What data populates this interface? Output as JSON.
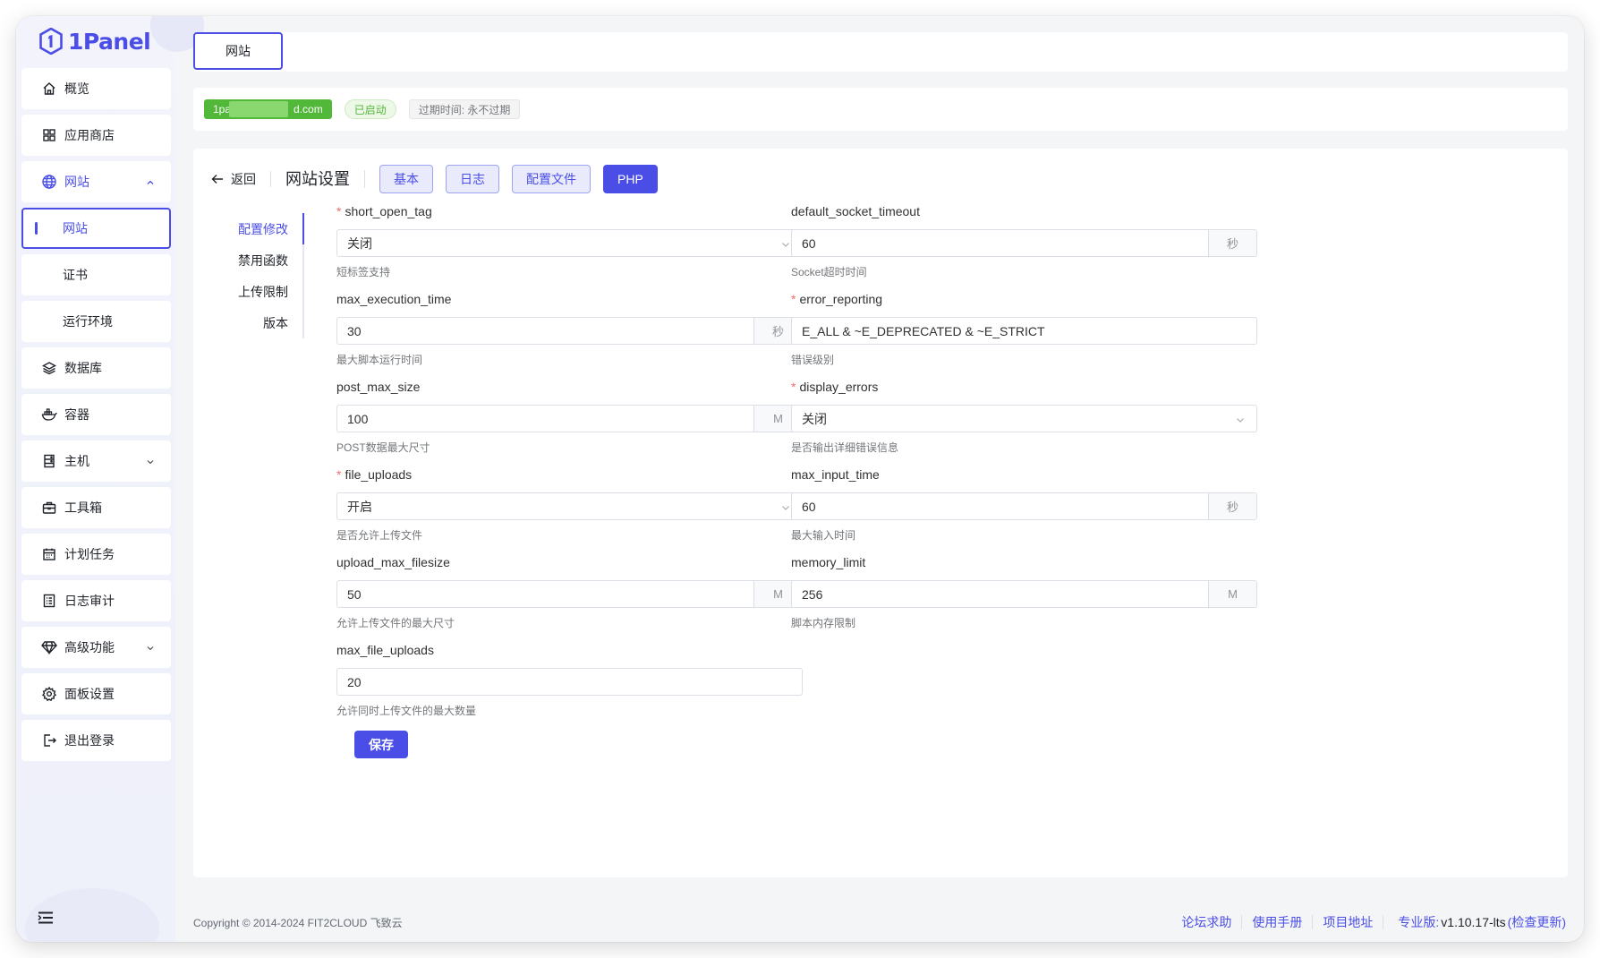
{
  "app": {
    "name": "1Panel"
  },
  "sidebar": {
    "items": [
      {
        "label": "概览"
      },
      {
        "label": "应用商店"
      },
      {
        "label": "网站"
      },
      {
        "label": "网站"
      },
      {
        "label": "证书"
      },
      {
        "label": "运行环境"
      },
      {
        "label": "数据库"
      },
      {
        "label": "容器"
      },
      {
        "label": "主机"
      },
      {
        "label": "工具箱"
      },
      {
        "label": "计划任务"
      },
      {
        "label": "日志审计"
      },
      {
        "label": "高级功能"
      },
      {
        "label": "面板设置"
      },
      {
        "label": "退出登录"
      }
    ]
  },
  "tabs": {
    "active": "网站"
  },
  "site": {
    "domain_prefix": "1pa",
    "domain_suffix": "d.com",
    "status": "已启动",
    "expire": "过期时间: 永不过期"
  },
  "header": {
    "back": "返回",
    "title": "网站设置",
    "buttons": [
      "基本",
      "日志",
      "配置文件",
      "PHP"
    ]
  },
  "subnav": [
    "配置修改",
    "禁用函数",
    "上传限制",
    "版本"
  ],
  "form": {
    "short_open_tag": {
      "label": "short_open_tag",
      "value": "关闭",
      "help": "短标签支持"
    },
    "default_socket_timeout": {
      "label": "default_socket_timeout",
      "value": "60",
      "unit": "秒",
      "help": "Socket超时时间"
    },
    "max_execution_time": {
      "label": "max_execution_time",
      "value": "30",
      "unit": "秒",
      "help": "最大脚本运行时间"
    },
    "error_reporting": {
      "label": "error_reporting",
      "value": "E_ALL & ~E_DEPRECATED & ~E_STRICT",
      "help": "错误级别"
    },
    "post_max_size": {
      "label": "post_max_size",
      "value": "100",
      "unit": "M",
      "help": "POST数据最大尺寸"
    },
    "display_errors": {
      "label": "display_errors",
      "value": "关闭",
      "help": "是否输出详细错误信息"
    },
    "file_uploads": {
      "label": "file_uploads",
      "value": "开启",
      "help": "是否允许上传文件"
    },
    "max_input_time": {
      "label": "max_input_time",
      "value": "60",
      "unit": "秒",
      "help": "最大输入时间"
    },
    "upload_max_filesize": {
      "label": "upload_max_filesize",
      "value": "50",
      "unit": "M",
      "help": "允许上传文件的最大尺寸"
    },
    "memory_limit": {
      "label": "memory_limit",
      "value": "256",
      "unit": "M",
      "help": "脚本内存限制"
    },
    "max_file_uploads": {
      "label": "max_file_uploads",
      "value": "20",
      "help": "允许同时上传文件的最大数量"
    },
    "save": "保存"
  },
  "footer": {
    "copyright": "Copyright © 2014-2024 FIT2CLOUD 飞致云",
    "links": [
      "论坛求助",
      "使用手册",
      "项目地址"
    ],
    "edition": "专业版:",
    "version": "v1.10.17-lts",
    "check_update": "(检查更新)"
  },
  "colors": {
    "primary": "#4a4ee6",
    "success": "#52b83a",
    "required": "#f56c6c"
  }
}
